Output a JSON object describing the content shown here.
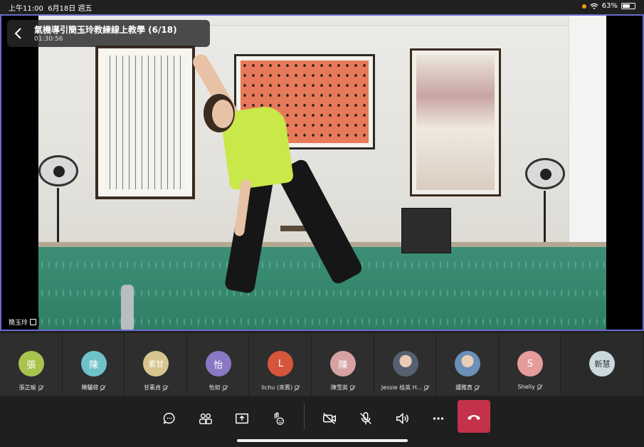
{
  "status_bar": {
    "time": "上午11:00",
    "date": "6月18日 週五",
    "battery": "63%",
    "battery_level": 0.63
  },
  "meeting": {
    "title": "氣機導引簡玉玲教練線上教學 (6/18)",
    "duration": "01:30:56",
    "speaker_name": "簡玉玲"
  },
  "participants": [
    {
      "initials": "張",
      "name": "張芷瑜",
      "color": "#a8c34e",
      "muted": true
    },
    {
      "initials": "陳",
      "name": "陳驪荷",
      "color": "#6fc3c8",
      "muted": true
    },
    {
      "initials": "素甘",
      "name": "甘素貞",
      "color": "#d6c58f",
      "muted": true
    },
    {
      "initials": "怡",
      "name": "怡如",
      "color": "#8a78c4",
      "muted": true
    },
    {
      "initials": "L",
      "name": "lichu (來賓)",
      "color": "#d5563b",
      "muted": true
    },
    {
      "initials": "陳",
      "name": "陳雪英",
      "color": "#d7a2a2",
      "muted": true
    },
    {
      "initials": "",
      "name": "Jessie 桂英 H...",
      "color": "#556070",
      "muted": true
    },
    {
      "initials": "",
      "name": "鍾雅真",
      "color": "#6a8fb8",
      "muted": true
    },
    {
      "initials": "S",
      "name": "Shelly",
      "color": "#e79c9c",
      "muted": true
    },
    {
      "initials": "新慧",
      "name": "",
      "color": "#c9d9dd",
      "muted": false
    }
  ],
  "icons": {
    "back": "back-chevron-icon",
    "chat": "chat-icon",
    "people": "participants-icon",
    "share": "share-screen-icon",
    "raise_hand": "raise-hand-icon",
    "camera": "camera-off-icon",
    "mic": "mic-off-icon",
    "speaker": "speaker-icon",
    "more": "more-icon",
    "end": "end-call-icon"
  },
  "colors": {
    "accent_border": "#6a6ad0",
    "end_call": "#c4314b"
  }
}
